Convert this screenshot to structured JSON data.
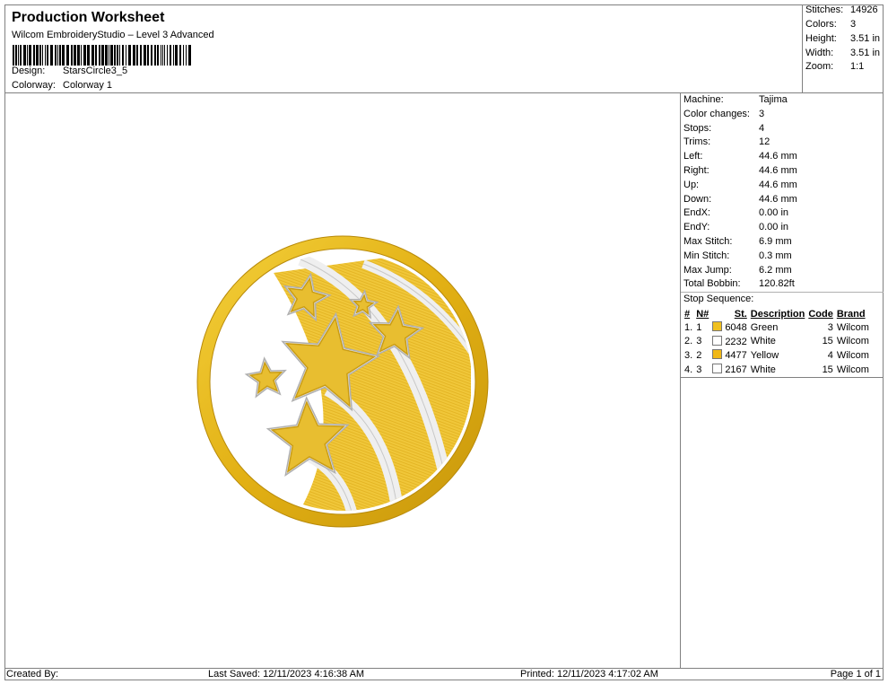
{
  "header": {
    "title": "Production Worksheet",
    "subtitle": "Wilcom EmbroideryStudio – Level 3 Advanced",
    "design_label": "Design:",
    "design_value": "StarsCircle3_5",
    "colorway_label": "Colorway:",
    "colorway_value": "Colorway 1"
  },
  "stats": [
    {
      "label": "Stitches:",
      "value": "14926"
    },
    {
      "label": "Colors:",
      "value": "3"
    },
    {
      "label": "Height:",
      "value": "3.51 in"
    },
    {
      "label": "Width:",
      "value": "3.51 in"
    },
    {
      "label": "Zoom:",
      "value": "1:1"
    }
  ],
  "machine_info": [
    {
      "label": "Machine:",
      "value": "Tajima"
    },
    {
      "label": "Color changes:",
      "value": "3"
    },
    {
      "label": "Stops:",
      "value": "4"
    },
    {
      "label": "Trims:",
      "value": "12"
    },
    {
      "label": "Left:",
      "value": "44.6 mm"
    },
    {
      "label": "Right:",
      "value": "44.6 mm"
    },
    {
      "label": "Up:",
      "value": "44.6 mm"
    },
    {
      "label": "Down:",
      "value": "44.6 mm"
    },
    {
      "label": "EndX:",
      "value": "0.00 in"
    },
    {
      "label": "EndY:",
      "value": "0.00 in"
    },
    {
      "label": "Max Stitch:",
      "value": "6.9 mm"
    },
    {
      "label": "Min Stitch:",
      "value": "0.3 mm"
    },
    {
      "label": "Max Jump:",
      "value": "6.2 mm"
    },
    {
      "label": "Total Bobbin:",
      "value": "120.82ft"
    }
  ],
  "stop_sequence": {
    "title": "Stop Sequence:",
    "headers": [
      "#",
      "N#",
      "St.",
      "Description",
      "Code",
      "Brand"
    ],
    "rows": [
      {
        "num": "1.",
        "n": "1",
        "color": "#f0c020",
        "st": "6048",
        "desc": "Green",
        "code": "3",
        "brand": "Wilcom"
      },
      {
        "num": "2.",
        "n": "3",
        "color": "#ffffff",
        "st": "2232",
        "desc": "White",
        "code": "15",
        "brand": "Wilcom"
      },
      {
        "num": "3.",
        "n": "2",
        "color": "#f0b818",
        "st": "4477",
        "desc": "Yellow",
        "code": "4",
        "brand": "Wilcom"
      },
      {
        "num": "4.",
        "n": "3",
        "color": "#ffffff",
        "st": "2167",
        "desc": "White",
        "code": "15",
        "brand": "Wilcom"
      }
    ]
  },
  "footer": {
    "created_by": "Created By:",
    "last_saved": "Last Saved: 12/11/2023 4:16:38 AM",
    "printed": "Printed: 12/11/2023 4:17:02 AM",
    "page": "Page 1 of 1"
  },
  "colors": {
    "gold": "#e8b818",
    "gold_dark": "#c89a10",
    "white_thread": "#f2f2f2"
  }
}
